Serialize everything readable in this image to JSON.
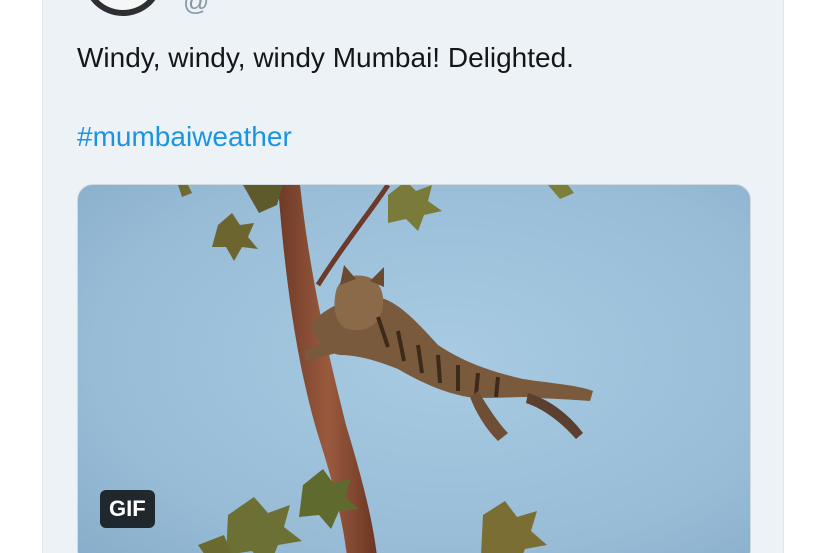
{
  "tweet": {
    "handle": "@",
    "text": "Windy, windy, windy Mumbai! Delighted.",
    "hashtag": "#mumbaiweather",
    "media": {
      "badge": "GIF"
    }
  },
  "colors": {
    "card_background": "#edf2f6",
    "hashtag": "#1b95e0",
    "text": "#14171a",
    "sky": "#9fc2dc"
  }
}
